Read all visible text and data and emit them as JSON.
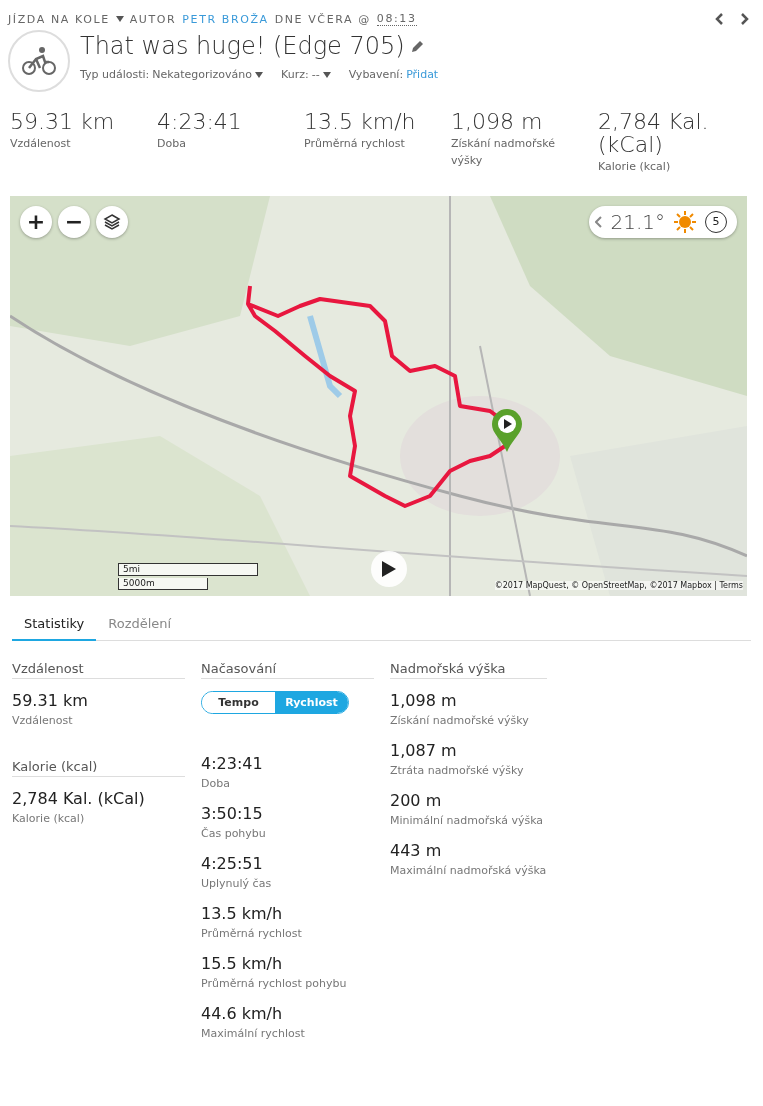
{
  "breadcrumb": {
    "activity_type": "JÍZDA NA KOLE",
    "author_label": "AUTOR",
    "author": "PETR BROŽA",
    "date_label": "DNE VČERA @",
    "time": "08:13"
  },
  "title": "That was huge! (Edge 705)",
  "meta": [
    {
      "label": "Typ události:",
      "value": "Nekategorizováno",
      "kind": "dropdown"
    },
    {
      "label": "Kurz:",
      "value": "--",
      "kind": "dropdown"
    },
    {
      "label": "Vybavení:",
      "value": "Přidat",
      "kind": "link"
    }
  ],
  "summary": [
    {
      "value": "59.31 km",
      "label": "Vzdálenost"
    },
    {
      "value": "4:23:41",
      "label": "Doba"
    },
    {
      "value": "13.5 km/h",
      "label": "Průměrná rychlost"
    },
    {
      "value": "1,098 m",
      "label": "Získání nadmořské výšky"
    },
    {
      "value": "2,784 Kal. (kCal)",
      "label": "Kalorie (kcal)"
    }
  ],
  "map": {
    "kind": "picture",
    "zoom_in": "+",
    "zoom_out": "−",
    "temperature": "21.1°",
    "wind": "5",
    "scale_imperial": "5mi",
    "scale_metric": "5000m",
    "attribution": "©2017 MapQuest, © OpenStreetMap, ©2017 Mapbox | Terms"
  },
  "tabs": [
    {
      "label": "Statistiky",
      "selected": true
    },
    {
      "label": "Rozdělení",
      "selected": false
    }
  ],
  "columns": [
    {
      "sections": [
        {
          "title": "Vzdálenost",
          "stats": [
            {
              "value": "59.31 km",
              "label": "Vzdálenost"
            }
          ]
        },
        {
          "title": "Kalorie (kcal)",
          "stats": [
            {
              "value": "2,784 Kal. (kCal)",
              "label": "Kalorie (kcal)"
            }
          ]
        }
      ]
    },
    {
      "sections": [
        {
          "title": "Načasování",
          "toggle": [
            {
              "label": "Tempo",
              "selected": false
            },
            {
              "label": "Rychlost",
              "selected": true
            }
          ],
          "stats": [
            {
              "value": "4:23:41",
              "label": "Doba"
            },
            {
              "value": "3:50:15",
              "label": "Čas pohybu"
            },
            {
              "value": "4:25:51",
              "label": "Uplynulý čas"
            },
            {
              "value": "13.5 km/h",
              "label": "Průměrná rychlost"
            },
            {
              "value": "15.5 km/h",
              "label": "Průměrná rychlost pohybu"
            },
            {
              "value": "44.6 km/h",
              "label": "Maximální rychlost"
            }
          ]
        }
      ]
    },
    {
      "sections": [
        {
          "title": "Nadmořská výška",
          "stats": [
            {
              "value": "1,098 m",
              "label": "Získání nadmořské výšky"
            },
            {
              "value": "1,087 m",
              "label": "Ztráta nadmořské výšky"
            },
            {
              "value": "200 m",
              "label": "Minimální nadmořská výška"
            },
            {
              "value": "443 m",
              "label": "Maximální nadmořská výška"
            }
          ]
        }
      ]
    }
  ]
}
